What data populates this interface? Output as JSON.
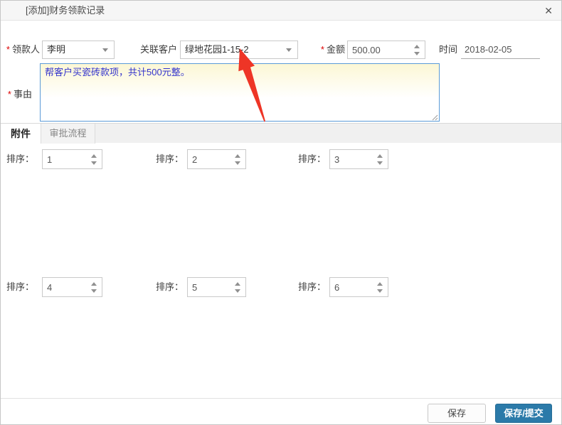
{
  "dialog": {
    "title": "[添加]财务领款记录",
    "close_icon": "✕"
  },
  "icons": {
    "close": "x-icon",
    "dropdown_arrow": "triangle-down-icon",
    "spinner_up": "triangle-up-icon",
    "spinner_down": "triangle-down-icon",
    "resize_handle": "diagonal-grip-icon",
    "annotation_arrow": "red-arrow-icon"
  },
  "form": {
    "required_marker": "*",
    "payee": {
      "label": "领款人",
      "required": true,
      "value": "李明"
    },
    "customer": {
      "label": "关联客户",
      "required": false,
      "value": "绿地花园1-15-2"
    },
    "amount": {
      "label": "金额",
      "required": true,
      "value": "500.00"
    },
    "time": {
      "label": "时间",
      "value": "2018-02-05"
    },
    "reason": {
      "label": "事由",
      "required": true,
      "value": "帮客户买瓷砖款项，共计500元整。"
    }
  },
  "tabs": [
    {
      "label": "附件",
      "active": true
    },
    {
      "label": "审批流程",
      "active": false
    }
  ],
  "attachments": {
    "sort_label": "排序：",
    "items": [
      {
        "value": "1"
      },
      {
        "value": "2"
      },
      {
        "value": "3"
      },
      {
        "value": "4"
      },
      {
        "value": "5"
      },
      {
        "value": "6"
      }
    ]
  },
  "footer": {
    "save_label": "保存",
    "save_submit_label": "保存/提交"
  },
  "colors": {
    "accent_blue": "#2b7aa9",
    "textarea_border": "#5b9bd7",
    "textarea_text": "#3333cc",
    "arrow_red": "#ee3526",
    "required_red": "#dd0000",
    "tab_strip_bg": "#f0f0f0"
  }
}
